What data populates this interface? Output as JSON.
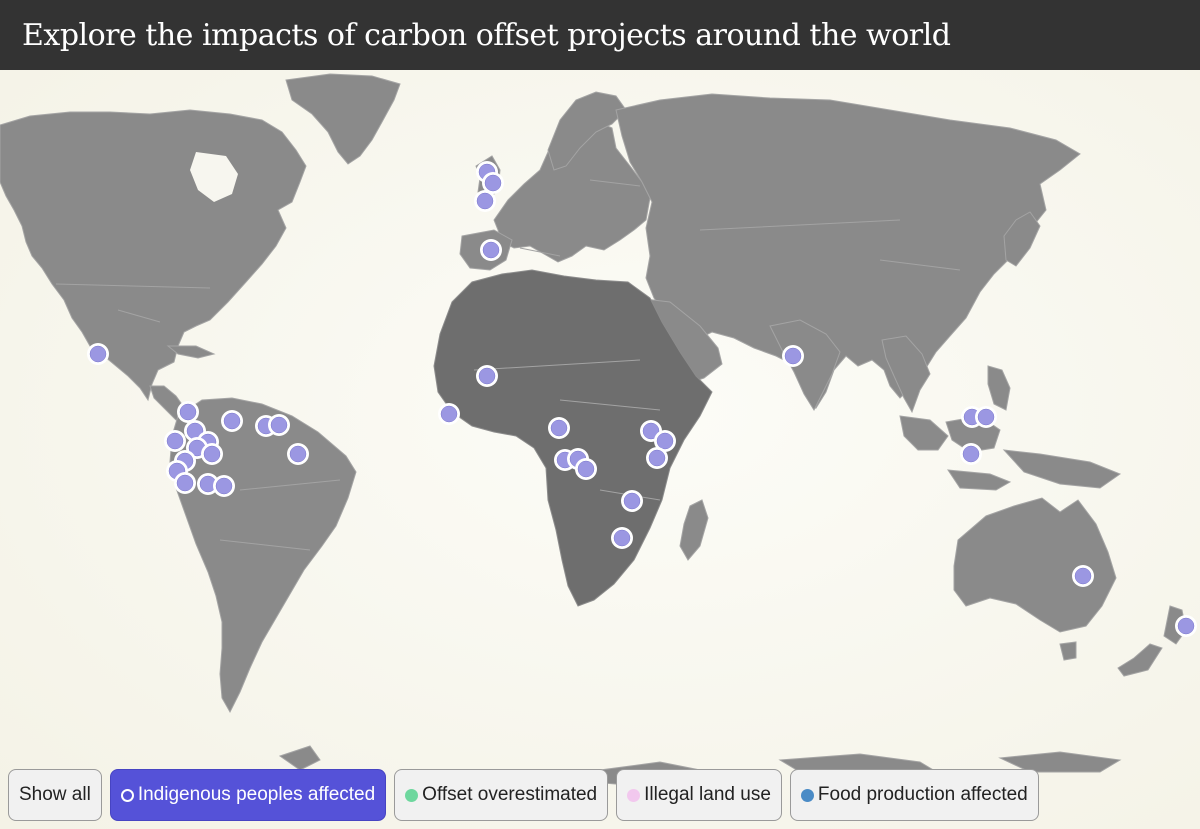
{
  "header": {
    "title": "Explore the impacts of carbon offset projects around the world"
  },
  "map": {
    "land_color": "#8a8a8a",
    "ocean_color": "#f7f6ef",
    "marker_color": "#9b97e2"
  },
  "filters": [
    {
      "label": "Show all",
      "active": false
    },
    {
      "label": "Indigenous peoples affected",
      "active": true,
      "icon": "ring-outline-icon"
    },
    {
      "label": "Offset overestimated",
      "active": false,
      "icon": "dot-icon",
      "color": "#6ed79e"
    },
    {
      "label": "Illegal land use",
      "active": false,
      "icon": "dot-icon",
      "color": "#f2c8ee"
    },
    {
      "label": "Food production affected",
      "active": false,
      "icon": "dot-icon",
      "color": "#4a8bc6"
    }
  ],
  "active_color": "#5552d8"
}
